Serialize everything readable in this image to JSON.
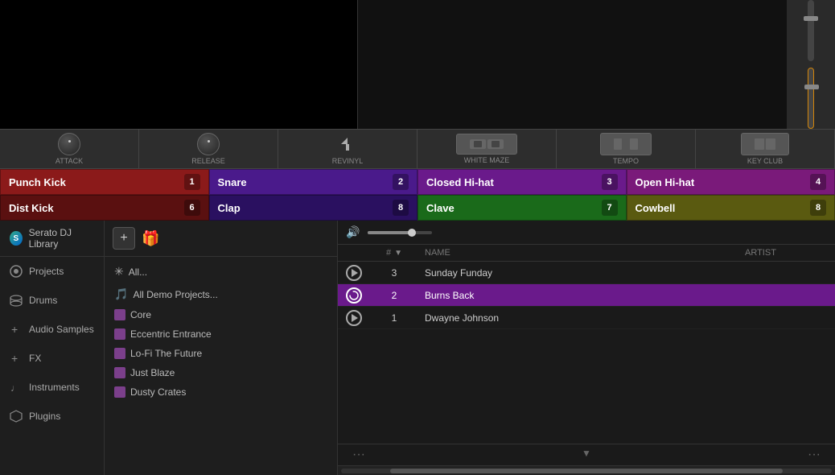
{
  "top": {
    "side_panel": {
      "fader_label": "fader"
    }
  },
  "controls": {
    "items": [
      {
        "label": "Attack",
        "type": "knob"
      },
      {
        "label": "Release",
        "type": "knob"
      },
      {
        "label": "Revinyl",
        "type": "button"
      },
      {
        "label": "White Maze",
        "type": "button-wide"
      },
      {
        "label": "Tempo",
        "type": "button-wide"
      },
      {
        "label": "Key Club",
        "type": "button-wide"
      }
    ]
  },
  "pads": [
    {
      "label": "Punch Kick",
      "number": "1",
      "color": "pad-red"
    },
    {
      "label": "Snare",
      "number": "2",
      "color": "pad-purple"
    },
    {
      "label": "Closed Hi-hat",
      "number": "3",
      "color": "pad-violet"
    },
    {
      "label": "Open Hi-hat",
      "number": "4",
      "color": "pad-magenta"
    },
    {
      "label": "Dist Kick",
      "number": "6",
      "color": "pad-dark-red"
    },
    {
      "label": "Clap",
      "number": "8",
      "color": "pad-dark-purple"
    },
    {
      "label": "Clave",
      "number": "7",
      "color": "pad-green"
    },
    {
      "label": "Cowbell",
      "number": "8",
      "color": "pad-olive"
    }
  ],
  "sidebar": {
    "items": [
      {
        "label": "Serato DJ Library",
        "icon": "♻",
        "type": "serato"
      },
      {
        "label": "Projects",
        "icon": "◎",
        "active": false
      },
      {
        "label": "Drums",
        "icon": "◉"
      },
      {
        "label": "Audio Samples",
        "icon": "+"
      },
      {
        "label": "FX",
        "icon": "+"
      },
      {
        "label": "Instruments",
        "icon": "♩"
      },
      {
        "label": "Plugins",
        "icon": "⬡"
      }
    ]
  },
  "file_browser": {
    "header": {
      "add_button": "+🎁"
    },
    "items": [
      {
        "label": "All...",
        "icon": "✳",
        "type": "all"
      },
      {
        "label": "All Demo Projects...",
        "icon": "folder",
        "type": "demo"
      },
      {
        "label": "Core",
        "icon": "crate-purple"
      },
      {
        "label": "Eccentric Entrance",
        "icon": "crate-purple"
      },
      {
        "label": "Lo-Fi The Future",
        "icon": "crate-purple"
      },
      {
        "label": "Just Blaze",
        "icon": "crate-purple"
      },
      {
        "label": "Dusty Crates",
        "icon": "crate-purple"
      }
    ]
  },
  "track_list": {
    "toolbar": {
      "volume_icon": "🔊"
    },
    "header": {
      "col_num": "#",
      "col_name": "NAME",
      "col_artist": "ARTIST"
    },
    "tracks": [
      {
        "number": 3,
        "name": "Sunday Funday",
        "artist": "",
        "active": false
      },
      {
        "number": 2,
        "name": "Burns Back",
        "artist": "",
        "active": true
      },
      {
        "number": 1,
        "name": "Dwayne Johnson",
        "artist": "",
        "active": false
      }
    ]
  }
}
